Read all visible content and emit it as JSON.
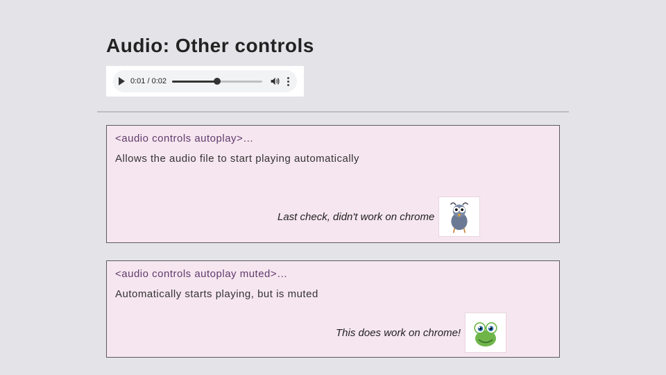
{
  "title": "Audio: Other controls",
  "player": {
    "time": "0:01 / 0:02"
  },
  "panels": [
    {
      "code": "<audio controls autoplay>…",
      "desc": "Allows the audio file to start playing automatically",
      "note": "Last check, didn't work on chrome",
      "creature": "bird"
    },
    {
      "code": "<audio controls autoplay muted>…",
      "desc": "Automatically starts playing, but is muted",
      "note": "This does work on chrome!",
      "creature": "frog"
    }
  ]
}
